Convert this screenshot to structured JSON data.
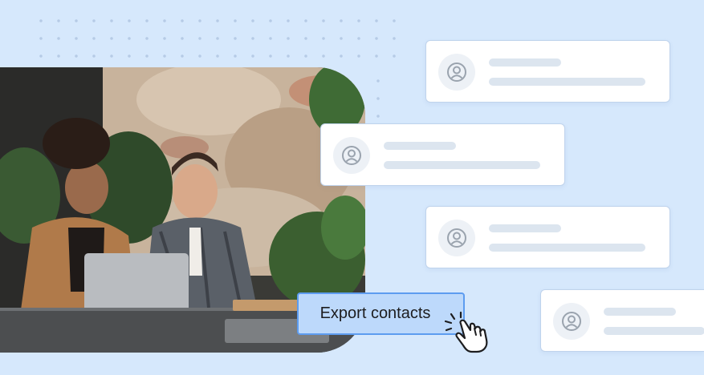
{
  "export_button": {
    "label": "Export contacts"
  },
  "contact_cards": [
    {
      "avatar_icon": "user-circle-icon"
    },
    {
      "avatar_icon": "user-circle-icon"
    },
    {
      "avatar_icon": "user-circle-icon"
    },
    {
      "avatar_icon": "user-circle-icon"
    }
  ],
  "photo": {
    "description_icon": "photo-two-people-laptop"
  },
  "cursor_icon": "hand-pointer-click-icon",
  "colors": {
    "background": "#d6e8fc",
    "button_fill": "#bdd9fb",
    "button_border": "#5d9cf0",
    "placeholder_bar": "#dce5ef",
    "avatar_icon": "#9aa3ae"
  }
}
